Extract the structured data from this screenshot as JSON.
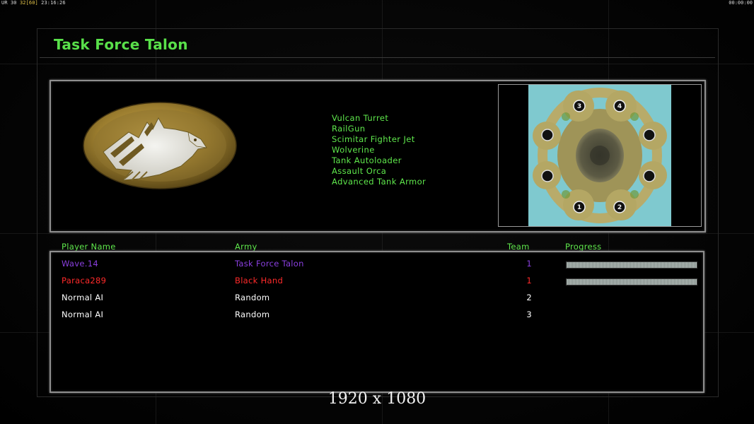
{
  "hud": {
    "left_prefix": "UR",
    "left_fps": "30",
    "left_frame": "32",
    "left_bracket": "[60]",
    "left_clock": "23:16:26",
    "right_clock": "00:00:00"
  },
  "title": "Task Force Talon",
  "bonuses": [
    "Vulcan Turret",
    "RailGun",
    "Scimitar Fighter Jet",
    "Wolverine",
    "Tank Autoloader",
    "Assault Orca",
    "Advanced Tank Armor"
  ],
  "map": {
    "slots": [
      "3",
      "4",
      "1",
      "2"
    ]
  },
  "columns": {
    "player": "Player Name",
    "army": "Army",
    "team": "Team",
    "progress": "Progress"
  },
  "players": [
    {
      "name": "Wave.14",
      "army": "Task Force Talon",
      "team": "1",
      "color": "#8a3fe0",
      "progress": 1.0
    },
    {
      "name": "Paraca289",
      "army": "Black Hand",
      "team": "1",
      "color": "#ff2a2a",
      "progress": 1.0
    },
    {
      "name": "Normal AI",
      "army": "Random",
      "team": "2",
      "color": "#ffffff"
    },
    {
      "name": "Normal AI",
      "army": "Random",
      "team": "3",
      "color": "#ffffff"
    }
  ],
  "resolution_label": "1920 x 1080",
  "colors": {
    "accent_green": "#5fe84c",
    "title_green": "#59e04a",
    "panel_border": "#8e8e8e"
  }
}
